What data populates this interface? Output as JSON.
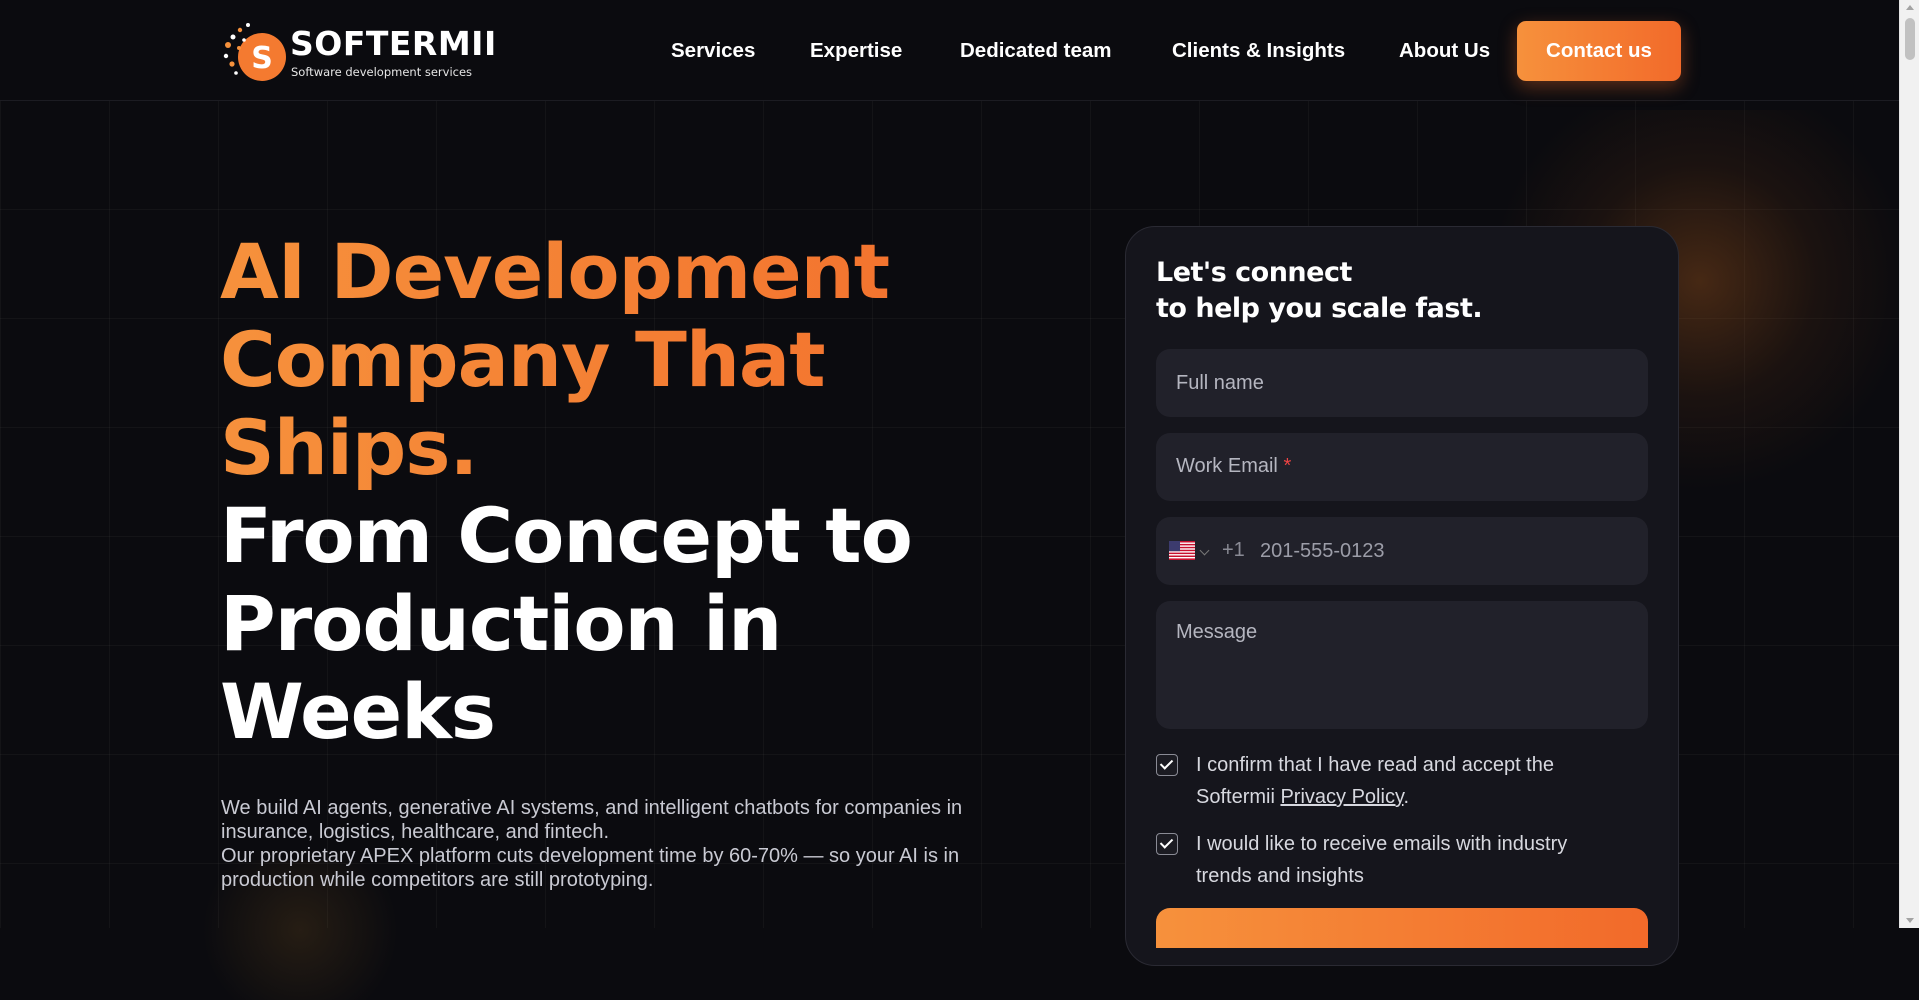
{
  "brand": {
    "name": "SOFTERMII",
    "tagline": "Software development services",
    "logo_letter": "S",
    "accent_start": "#f6913c",
    "accent_end": "#f26a2a"
  },
  "nav": {
    "items": [
      {
        "label": "Services"
      },
      {
        "label": "Expertise"
      },
      {
        "label": "Dedicated team"
      },
      {
        "label": "Clients & Insights"
      },
      {
        "label": "About Us"
      }
    ],
    "contact_label": "Contact us"
  },
  "hero": {
    "title_orange": [
      "AI Development",
      "Company That",
      "Ships."
    ],
    "title_white": [
      "From Concept to",
      "Production in",
      "Weeks"
    ],
    "description_1": "We build AI agents, generative AI systems, and intelligent chatbots for companies in insurance, logistics, healthcare, and fintech.",
    "description_2": "Our proprietary APEX platform cuts development time by 60-70% — so your AI is in production while competitors are still prototyping."
  },
  "form": {
    "title_line1": "Let's connect",
    "title_line2": "to help you scale fast.",
    "full_name_placeholder": "Full name",
    "full_name_value": "",
    "email_label": "Work Email",
    "email_required_mark": "*",
    "email_value": "",
    "phone_country": "US",
    "phone_dial_code": "+1",
    "phone_placeholder": "201-555-0123",
    "phone_value": "",
    "message_placeholder": "Message",
    "message_value": "",
    "consent_privacy_text": "I confirm that I have read and accept the Softermii",
    "consent_privacy_link": "Privacy Policy",
    "consent_privacy_suffix": ".",
    "consent_privacy_checked": true,
    "consent_emails_text": "I would like to receive emails with industry trends and insights",
    "consent_emails_checked": true
  }
}
